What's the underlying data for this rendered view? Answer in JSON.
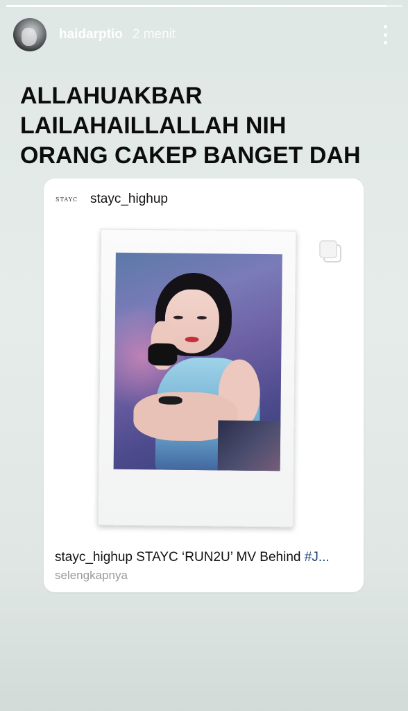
{
  "story": {
    "progress": 0.96,
    "username": "haidarptio",
    "timestamp": "2 menit",
    "caption_lines": [
      "ALLAHUAKBAR",
      "LAILAHAILLALLAH NIH",
      "ORANG CAKEP BANGET DAH"
    ]
  },
  "post": {
    "brand_logo": "STAYC",
    "username": "stayc_highup",
    "caption_user": "stayc_highup",
    "caption_text": "STAYC ‘RUN2U’ MV Behind",
    "caption_hashtag": "#J...",
    "see_more": "selengkapnya"
  },
  "icons": {
    "more": "more-vertical-icon",
    "carousel": "carousel-icon"
  },
  "colors": {
    "background": "#e2e9e7",
    "caption_text": "#0c0c0c",
    "hashtag": "#1e3f78",
    "muted": "#9a9a9a"
  }
}
